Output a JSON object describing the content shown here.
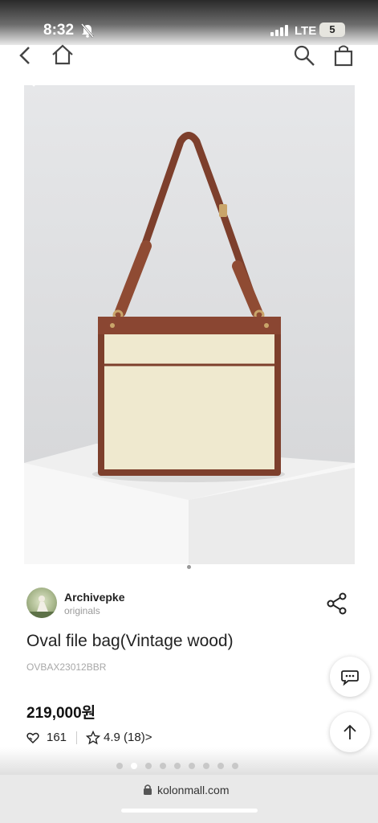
{
  "status_bar": {
    "time": "8:32",
    "network": "LTE",
    "battery": "5"
  },
  "brand": {
    "name": "Archivepke",
    "subtitle": "originals"
  },
  "product": {
    "title": "Oval file bag(Vintage wood)",
    "code": "OVBAX23012BBR",
    "price": "219,000원",
    "likes": "161",
    "rating": "4.9 (18)",
    "rating_chevron": ">"
  },
  "browser": {
    "url": "kolonmall.com"
  },
  "icons": {
    "nav": [
      "back-icon",
      "home-icon",
      "search-icon",
      "cart-icon",
      "close-icon"
    ],
    "actions": [
      "share-icon",
      "heart-icon",
      "star-icon",
      "chat-icon",
      "arrow-up-icon"
    ]
  },
  "colors": {
    "leather": "#7d3f2c",
    "canvas": "#efe9cf",
    "photo_background": "#dedfe1"
  }
}
